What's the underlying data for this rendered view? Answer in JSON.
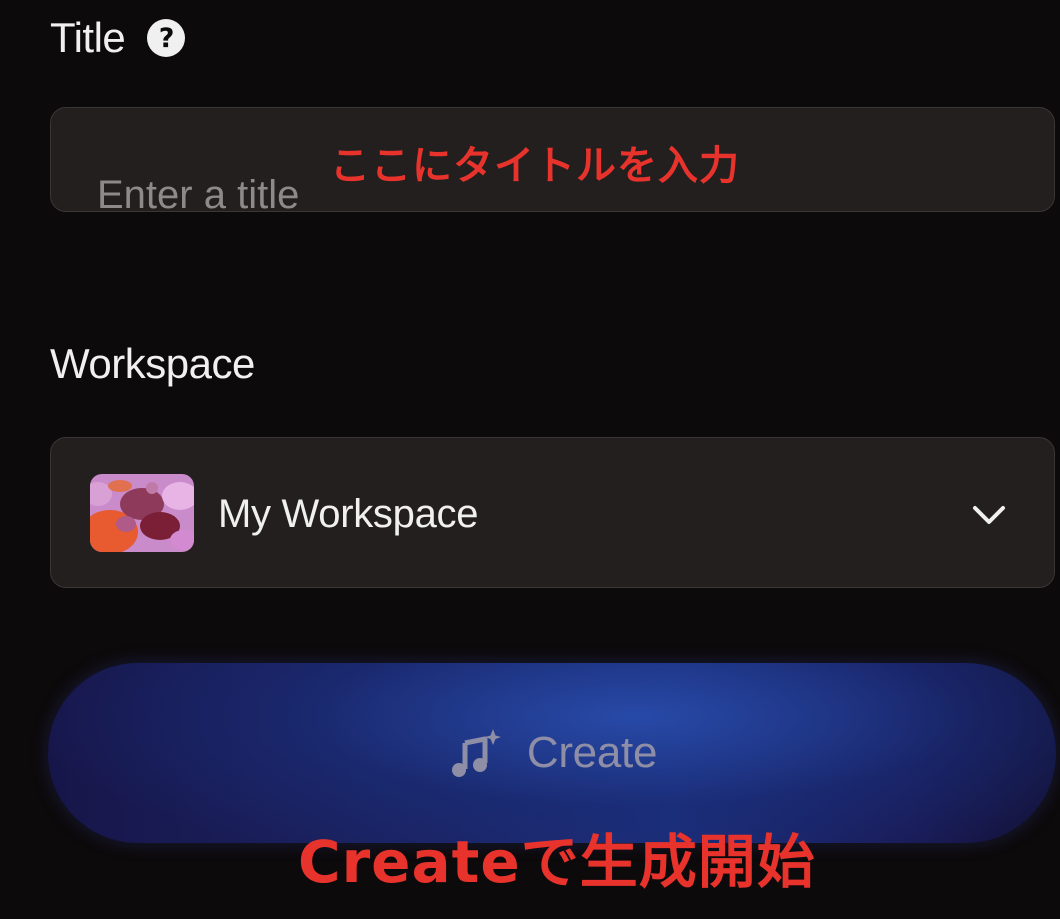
{
  "title_section": {
    "label": "Title",
    "help_icon": "question-circle-icon",
    "input_placeholder": "Enter a title",
    "input_value": ""
  },
  "workspace_section": {
    "label": "Workspace",
    "selected": "My Workspace",
    "avatar_icon": "workspace-avatar",
    "dropdown_icon": "chevron-down-icon"
  },
  "create_button": {
    "label": "Create",
    "icon": "music-note-sparkle-icon"
  },
  "annotations": {
    "title_hint": "ここにタイトルを入力",
    "create_hint": "Createで生成開始"
  },
  "colors": {
    "background": "#0d0a0b",
    "field_background": "#231f1f",
    "annotation_red": "#e8332c",
    "button_blue": "#1d2e7a"
  }
}
